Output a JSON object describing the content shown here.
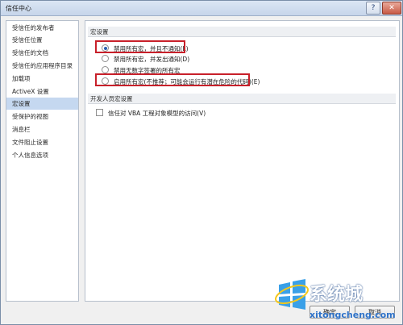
{
  "window": {
    "title": "信任中心",
    "help_label": "?",
    "close_label": "✕"
  },
  "sidebar": {
    "items": [
      {
        "label": "受信任的发布者",
        "selected": false
      },
      {
        "label": "受信任位置",
        "selected": false
      },
      {
        "label": "受信任的文档",
        "selected": false
      },
      {
        "label": "受信任的应用程序目录",
        "selected": false
      },
      {
        "label": "加载项",
        "selected": false
      },
      {
        "label": "ActiveX 设置",
        "selected": false
      },
      {
        "label": "宏设置",
        "selected": true
      },
      {
        "label": "受保护的视图",
        "selected": false
      },
      {
        "label": "消息栏",
        "selected": false
      },
      {
        "label": "文件阻止设置",
        "selected": false
      },
      {
        "label": "个人信息选项",
        "selected": false
      }
    ]
  },
  "macro_settings": {
    "header": "宏设置",
    "options": [
      {
        "label": "禁用所有宏，并且不通知(L)",
        "checked": true
      },
      {
        "label": "禁用所有宏，并发出通知(D)",
        "checked": false
      },
      {
        "label": "禁用无数字签署的所有宏",
        "checked": false
      },
      {
        "label": "启用所有宏(不推荐；可能会运行有潜在危险的代码)(E)",
        "checked": false
      }
    ]
  },
  "developer_settings": {
    "header": "开发人员宏设置",
    "vba_access_label": "信任对 VBA 工程对象模型的访问(V)",
    "vba_access_checked": false
  },
  "footer": {
    "ok_label": "确定",
    "cancel_label": "取消"
  },
  "watermark": {
    "title": "系统城",
    "url": "xitongcheng.com"
  },
  "colors": {
    "highlight": "#c8202a",
    "selected_nav": "#c5d8f0"
  }
}
